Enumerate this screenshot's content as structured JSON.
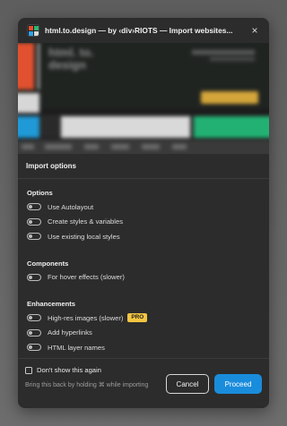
{
  "window": {
    "title": "html.to.design — by ‹div›RIOTS — Import websites...",
    "close_icon": "×"
  },
  "preview": {
    "blurred_text": "html. to. design"
  },
  "import_options": {
    "heading": "Import options",
    "groups": [
      {
        "title": "Options",
        "items": [
          {
            "label": "Use Autolayout"
          },
          {
            "label": "Create styles & variables"
          },
          {
            "label": "Use existing local styles"
          }
        ]
      },
      {
        "title": "Components",
        "items": [
          {
            "label": "For hover effects (slower)"
          }
        ]
      },
      {
        "title": "Enhancements",
        "items": [
          {
            "label": "High-res images (slower)",
            "badge": "PRO"
          },
          {
            "label": "Add hyperlinks"
          },
          {
            "label": "HTML layer names"
          }
        ]
      }
    ]
  },
  "footer": {
    "checkbox_label": "Don't show this again",
    "hint": "Bring this back by holding ⌘ while importing",
    "cancel_label": "Cancel",
    "proceed_label": "Proceed"
  },
  "colors": {
    "accent": "#1a8cdc",
    "badge": "#f4c542",
    "panel": "#2c2c2c"
  }
}
